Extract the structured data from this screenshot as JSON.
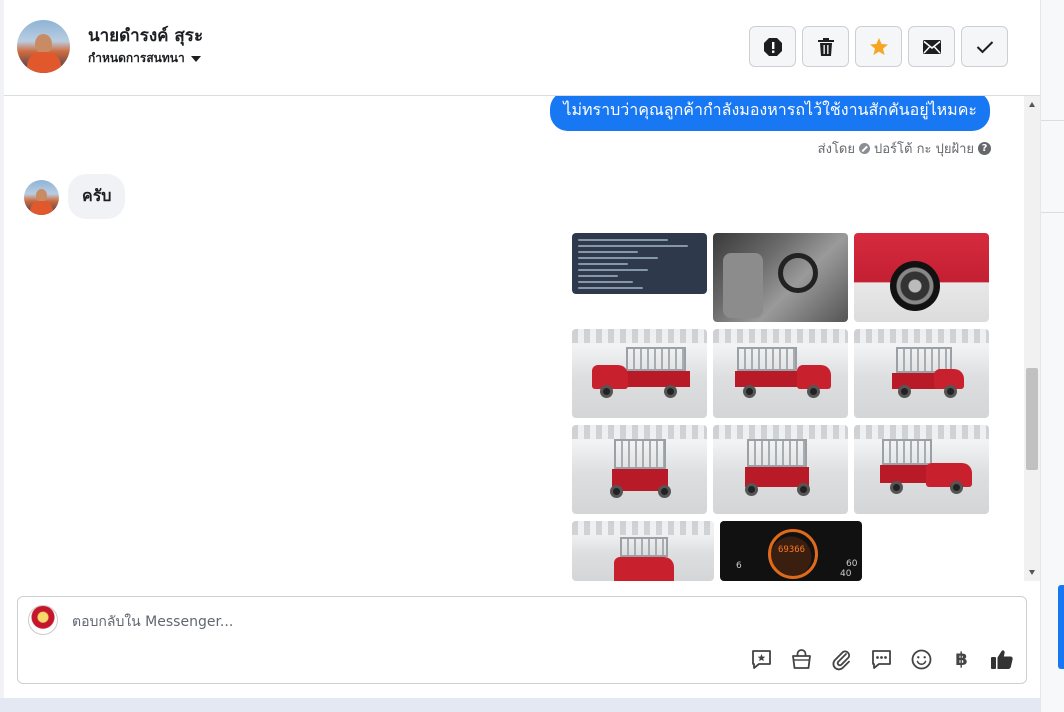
{
  "header": {
    "contact_name": "นายดำรงค์ สุระ",
    "assign_label": "กำหนดการสนทนา",
    "actions": [
      {
        "name": "spam-button",
        "icon": "alert-icon"
      },
      {
        "name": "delete-button",
        "icon": "trash-icon"
      },
      {
        "name": "follow-up-button",
        "icon": "star-icon",
        "color": "#f5a623"
      },
      {
        "name": "mark-unread-button",
        "icon": "envelope-icon"
      },
      {
        "name": "mark-done-button",
        "icon": "check-icon"
      }
    ]
  },
  "conversation": {
    "outgoing_message": "ไม่ทราบว่าคุณลูกค้ากำลังมองหารถไว้ใช้งานสักคันอยู่ไหมคะ",
    "sent_by_prefix": "ส่งโดย",
    "sent_by_name": "ปอร์โต้ กะ ปุยฝ้าย",
    "incoming_message": "ครับ",
    "gauge_reading": "69366",
    "gauge_left": "6",
    "gauge_right": "60",
    "gauge_right2": "40"
  },
  "composer": {
    "placeholder": "ตอบกลับใน Messenger...",
    "tools": [
      "saved-reply-icon",
      "shop-icon",
      "attachment-icon",
      "quick-reply-icon",
      "emoji-icon",
      "baht-icon",
      "like-icon"
    ],
    "baht_symbol": "฿"
  },
  "colors": {
    "accent": "#1877f2",
    "star": "#f5a623",
    "truck_red": "#c8202d"
  }
}
